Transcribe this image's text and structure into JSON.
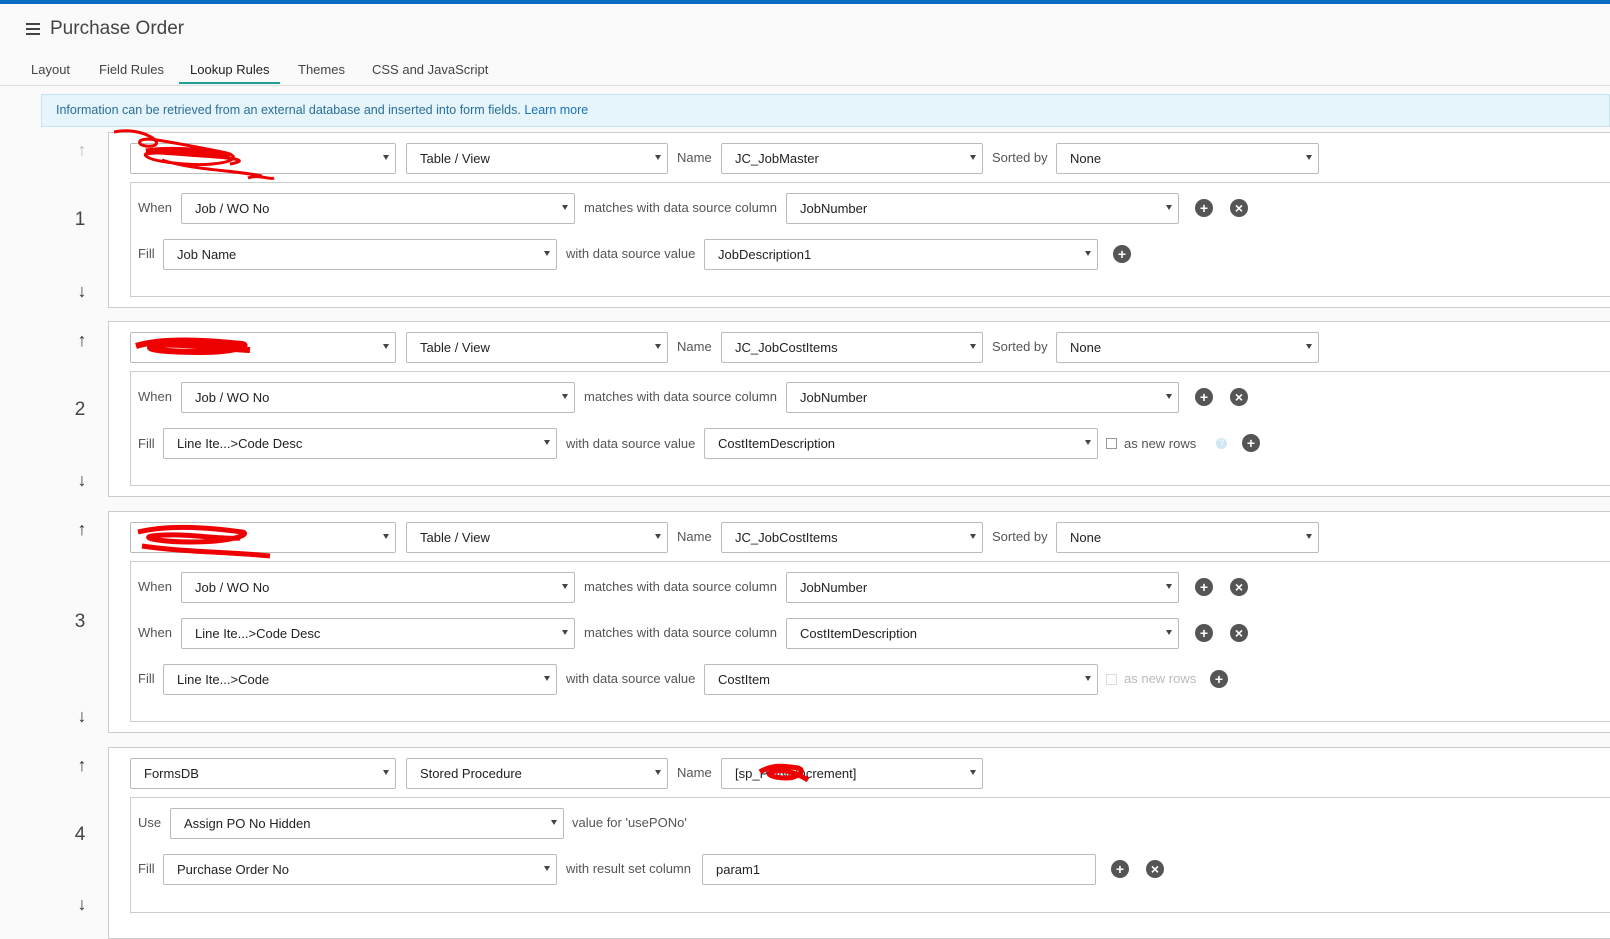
{
  "header": {
    "title": "Purchase Order"
  },
  "tabs": [
    "Layout",
    "Field Rules",
    "Lookup Rules",
    "Themes",
    "CSS and JavaScript"
  ],
  "info": {
    "text": "Information can be retrieved from an external database and inserted into form fields.",
    "link": "Learn more"
  },
  "labels": {
    "name": "Name",
    "sorted_by": "Sorted by",
    "when": "When",
    "fill": "Fill",
    "use": "Use",
    "matches": "matches with data source column",
    "with_value": "with data source value",
    "with_result": "with result set column",
    "as_new_rows": "as new rows"
  },
  "rules": [
    {
      "number": "1",
      "source": "",
      "type": "Table / View",
      "name": "JC_JobMaster",
      "sorted": "None",
      "when": [
        {
          "field": "Job / WO No",
          "column": "JobNumber"
        }
      ],
      "fill": {
        "field": "Job Name",
        "value": "JobDescription1"
      }
    },
    {
      "number": "2",
      "source": "",
      "type": "Table / View",
      "name": "JC_JobCostItems",
      "sorted": "None",
      "when": [
        {
          "field": "Job / WO No",
          "column": "JobNumber"
        }
      ],
      "fill": {
        "field": "Line Ite...>Code Desc",
        "value": "CostItemDescription"
      }
    },
    {
      "number": "3",
      "source": "",
      "type": "Table / View",
      "name": "JC_JobCostItems",
      "sorted": "None",
      "when": [
        {
          "field": "Job / WO No",
          "column": "JobNumber"
        },
        {
          "field": "Line Ite...>Code Desc",
          "column": "CostItemDescription"
        }
      ],
      "fill": {
        "field": "Line Ite...>Code",
        "value": "CostItem"
      }
    },
    {
      "number": "4",
      "source": "FormsDB",
      "type": "Stored Procedure",
      "name": "[sp_PONoIncrement]",
      "use": {
        "field": "Assign PO No Hidden",
        "suffix": "value for 'usePONo'"
      },
      "fill": {
        "field": "Purchase Order No",
        "value": "param1"
      }
    }
  ],
  "icons": {
    "add": "plus-circle-icon",
    "remove": "x-circle-icon",
    "up": "arrow-up-icon",
    "down": "arrow-down-icon",
    "help": "help-icon",
    "menu": "hamburger-icon"
  }
}
